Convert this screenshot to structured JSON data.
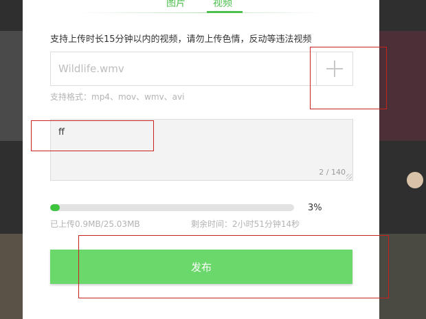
{
  "tabs": {
    "images": "图片",
    "video": "视频"
  },
  "notice": "支持上传时长15分钟以内的视频，请勿上传色情，反动等违法视频",
  "file_input": {
    "placeholder": "Wildlife.wmv"
  },
  "formats": "支持格式：mp4、mov、wmv、avi",
  "description": {
    "text": "ff",
    "char_count": "2 / 140"
  },
  "progress": {
    "percent_value": 3,
    "percent_label": "3%",
    "uploaded": "已上传0.9MB/25.03MB",
    "remaining": "剩余时间：2小时51分钟14秒"
  },
  "publish_label": "发布",
  "colors": {
    "accent": "#4cbf4c",
    "button": "#6ad86a",
    "progress": "#3ec43e",
    "annotation": "#c9211e"
  }
}
